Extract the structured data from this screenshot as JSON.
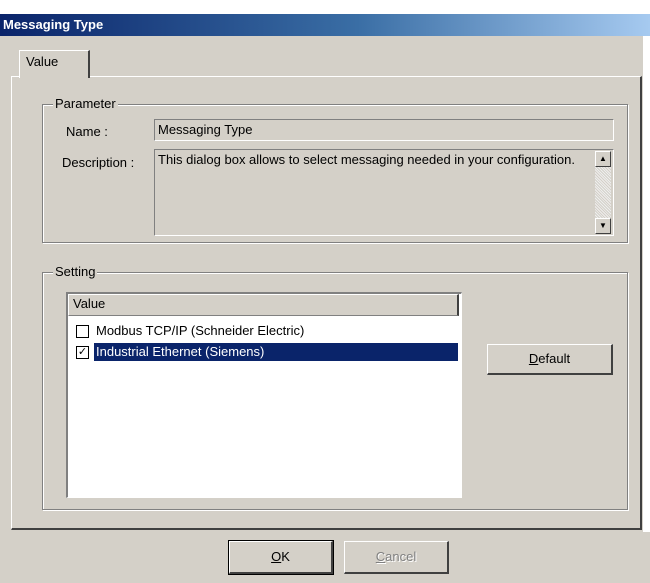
{
  "window": {
    "title": "Messaging Type"
  },
  "tabs": [
    {
      "label": "Value",
      "selected": true
    }
  ],
  "parameter": {
    "legend": "Parameter",
    "name_label": "Name :",
    "name_value": "Messaging Type",
    "description_label": "Description :",
    "description_value": "This dialog box allows to select messaging needed in your configuration."
  },
  "setting": {
    "legend": "Setting",
    "list_header": "Value",
    "items": [
      {
        "label": "Modbus TCP/IP (Schneider Electric)",
        "checked": false,
        "selected": false
      },
      {
        "label": "Industrial Ethernet (Siemens)",
        "checked": true,
        "selected": true
      }
    ],
    "default_button": "Default",
    "default_underline": "D",
    "default_rest": "efault"
  },
  "buttons": {
    "ok": {
      "underline": "O",
      "rest": "K",
      "enabled": true
    },
    "cancel": {
      "underline": "C",
      "rest": "ancel",
      "enabled": false
    }
  },
  "glyphs": {
    "check": "✓",
    "scroll_up": "▲",
    "scroll_down": "▼"
  },
  "colors": {
    "face": "#d4d0c8",
    "selection": "#0a246a",
    "title_start": "#0a246a"
  }
}
